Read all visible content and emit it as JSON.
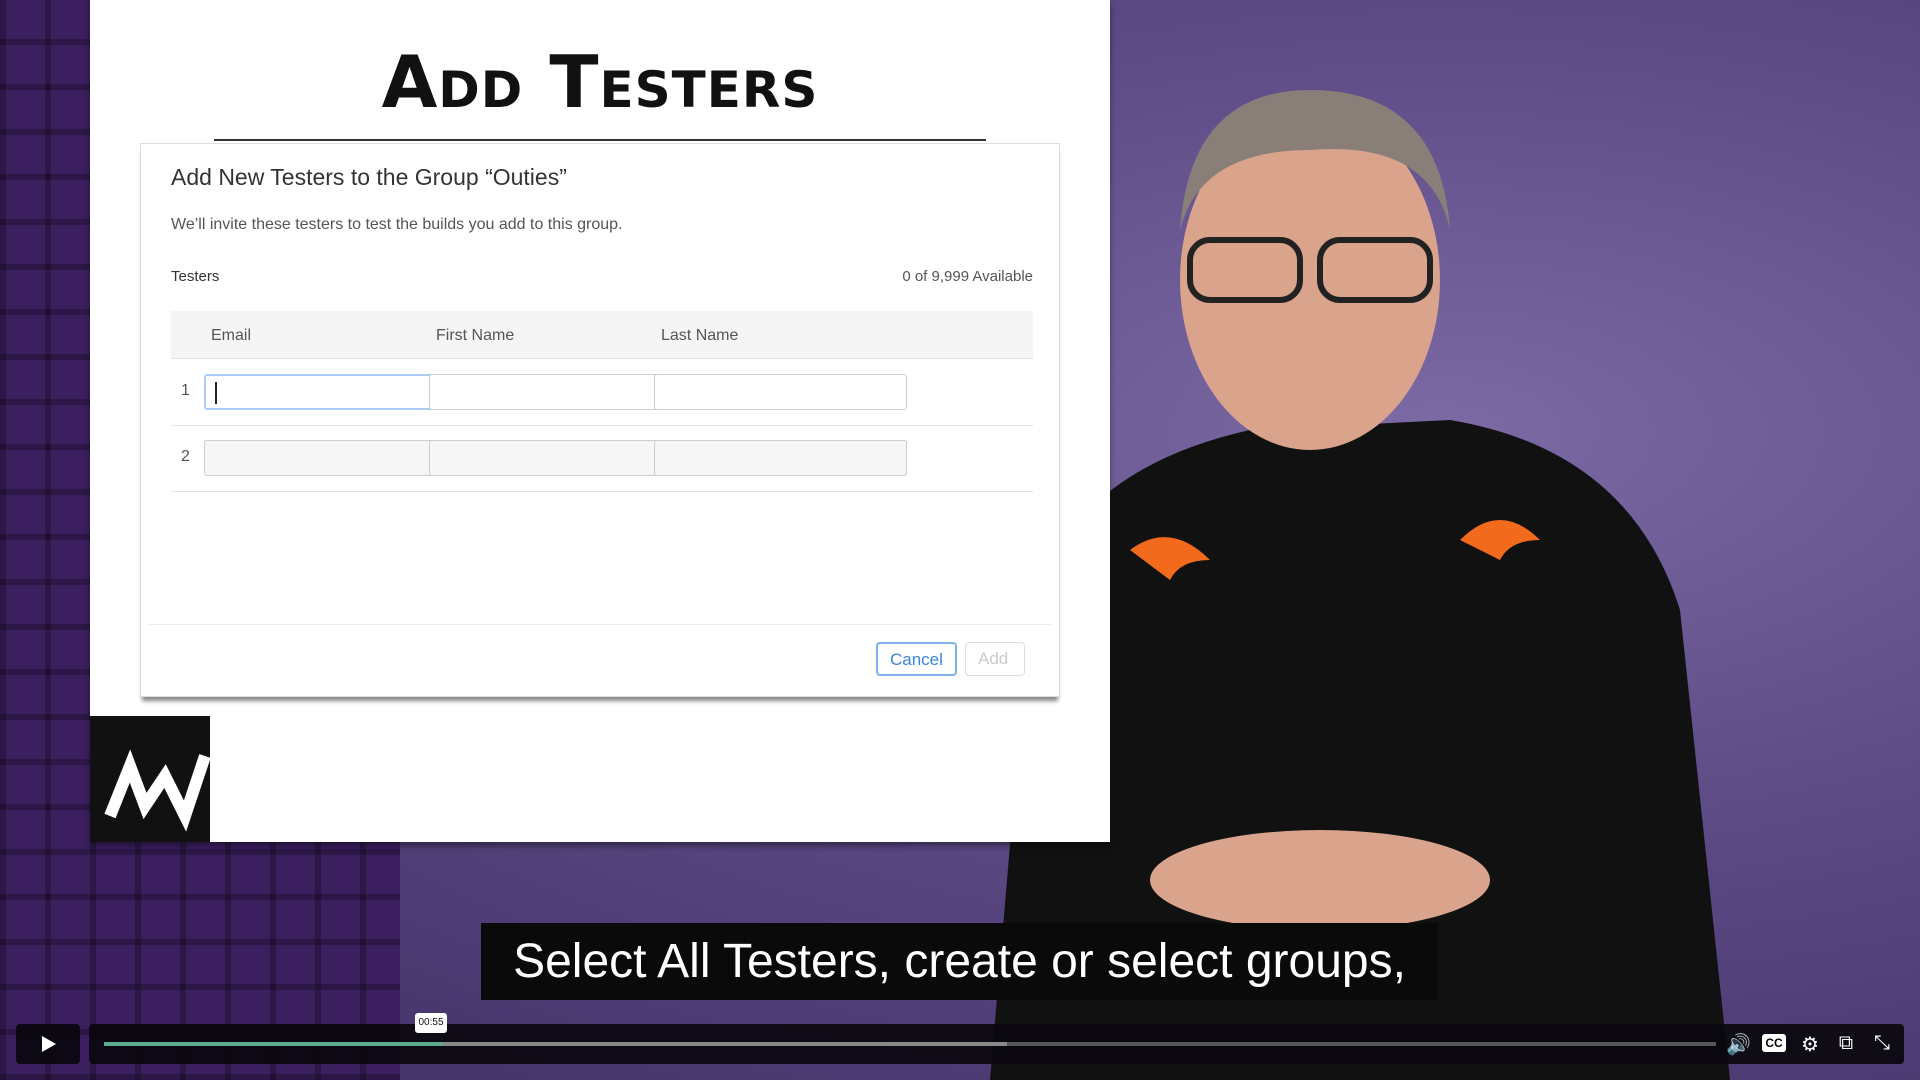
{
  "slide": {
    "title": "Add Testers"
  },
  "dialog": {
    "title": "Add New Testers to the Group “Outies”",
    "subtitle": "We’ll invite these testers to test the builds you add to this group.",
    "section_label": "Testers",
    "availability": "0 of 9,999 Available",
    "columns": [
      "Email",
      "First Name",
      "Last Name"
    ],
    "rows": [
      {
        "number": "1"
      },
      {
        "number": "2"
      }
    ],
    "cancel_label": "Cancel",
    "add_label": "Add"
  },
  "caption": "Select All Testers, create or select groups,",
  "player": {
    "time_tooltip": "00:55",
    "progress_percent": 21,
    "buffered_percent": 56,
    "accent": "#5ea88f",
    "icons": {
      "volume": "🔊",
      "cc": "CC",
      "settings": "⚙",
      "pip": "⧉",
      "fullscreen": "⤡"
    }
  }
}
